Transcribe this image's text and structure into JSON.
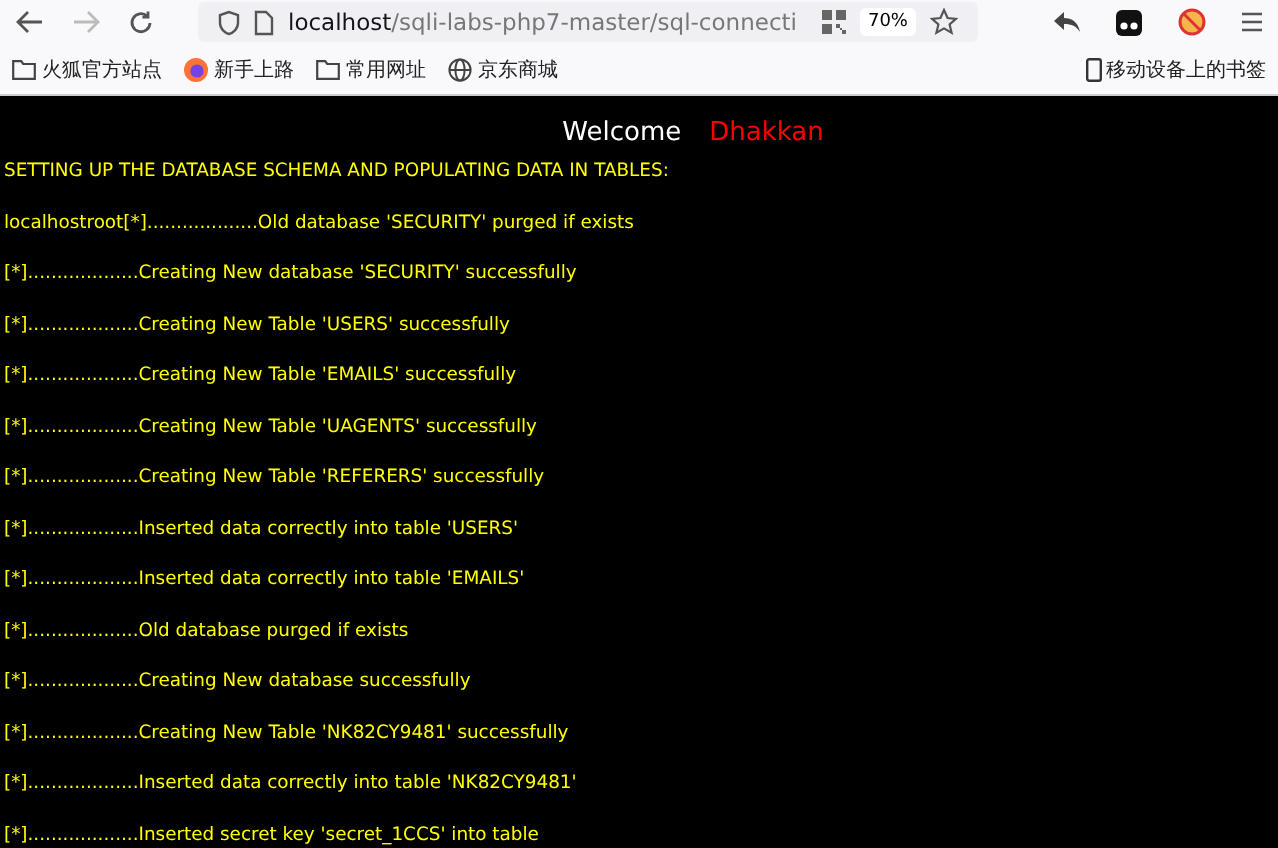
{
  "browser": {
    "url_host": "localhost",
    "url_path": "/sqli-labs-php7-master/sql-connecti",
    "zoom": "70%"
  },
  "bookmarks": [
    {
      "label": "火狐官方站点",
      "kind": "folder"
    },
    {
      "label": "新手上路",
      "kind": "firefox"
    },
    {
      "label": "常用网址",
      "kind": "folder"
    },
    {
      "label": "京东商城",
      "kind": "globe"
    }
  ],
  "mobile_bookmarks": "移动设备上的书签",
  "page": {
    "welcome": "Welcome",
    "name": "Dhakkan",
    "heading": "SETTING UP THE DATABASE SCHEMA AND POPULATING DATA IN TABLES:",
    "lines": [
      "localhostroot[*]...................Old database 'SECURITY' purged if exists",
      "[*]...................Creating New database 'SECURITY' successfully",
      "[*]...................Creating New Table 'USERS' successfully",
      "[*]...................Creating New Table 'EMAILS' successfully",
      "[*]...................Creating New Table 'UAGENTS' successfully",
      "[*]...................Creating New Table 'REFERERS' successfully",
      "[*]...................Inserted data correctly into table 'USERS'",
      "[*]...................Inserted data correctly into table 'EMAILS'",
      "[*]...................Old database purged if exists",
      "[*]...................Creating New database successfully",
      "[*]...................Creating New Table 'NK82CY9481' successfully",
      "[*]...................Inserted data correctly into table 'NK82CY9481'",
      "[*]...................Inserted secret key 'secret_1CCS' into table"
    ]
  }
}
